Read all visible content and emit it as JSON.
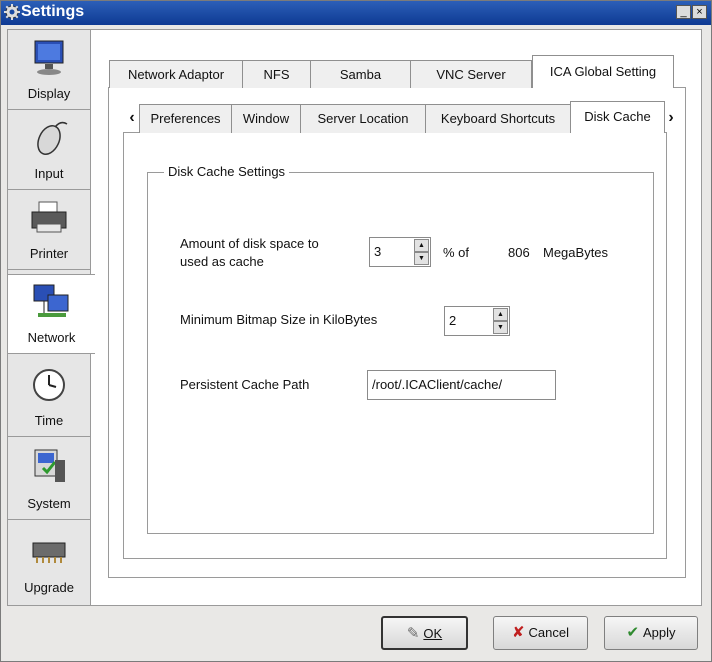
{
  "window": {
    "title": "Settings",
    "minimize_label": "_",
    "close_label": "×"
  },
  "sidebar": {
    "items": [
      {
        "label": "Display",
        "icon": "monitor-icon"
      },
      {
        "label": "Input",
        "icon": "mouse-icon"
      },
      {
        "label": "Printer",
        "icon": "printer-icon"
      },
      {
        "label": "Network",
        "icon": "network-icon",
        "active": true
      },
      {
        "label": "Time",
        "icon": "clock-icon"
      },
      {
        "label": "System",
        "icon": "system-icon"
      },
      {
        "label": "Upgrade",
        "icon": "chip-icon"
      }
    ]
  },
  "outer_tabs": [
    "Network Adaptor",
    "NFS",
    "Samba",
    "VNC Server",
    "ICA Global Setting"
  ],
  "inner_tabs": [
    "Preferences",
    "Window",
    "Server Location",
    "Keyboard Shortcuts",
    "Disk Cache"
  ],
  "disk_cache": {
    "group_title": "Disk Cache Settings",
    "amount_label_line1": "Amount of disk space to",
    "amount_label_line2": "used as cache",
    "amount_value": "3",
    "percent_of": "% of",
    "total_mb": "806",
    "megabytes": "MegaBytes",
    "min_bitmap_label": "Minimum Bitmap Size in KiloBytes",
    "min_bitmap_value": "2",
    "cache_path_label": "Persistent Cache Path",
    "cache_path_value": "/root/.ICAClient/cache/"
  },
  "buttons": {
    "ok": "OK",
    "cancel": "Cancel",
    "apply": "Apply"
  },
  "colors": {
    "titlebar": "#1a4aa3",
    "panel": "#ffffff",
    "chrome": "#e9e8e6"
  }
}
